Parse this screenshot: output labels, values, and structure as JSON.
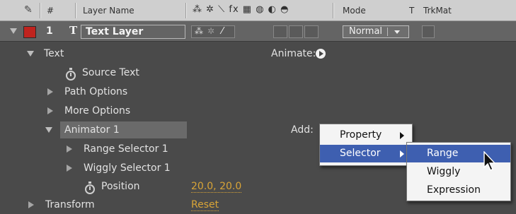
{
  "header": {
    "hash": "#",
    "layer_name": "Layer Name",
    "switch_icons": "⁂ ✲ ⟍ fx ▦ ◍ ◐ ◓",
    "mode": "Mode",
    "t": "T",
    "trkmat": "TrkMat"
  },
  "layer": {
    "number": "1",
    "type_icon": "T",
    "name": "Text Layer",
    "label_color": "#c0231e",
    "mode_value": "Normal"
  },
  "tree": {
    "text": "Text",
    "animate_label": "Animate:",
    "source_text": "Source Text",
    "path_options": "Path Options",
    "more_options": "More Options",
    "animator": "Animator 1",
    "add_label": "Add:",
    "range_selector": "Range Selector 1",
    "wiggly_selector": "Wiggly Selector 1",
    "position_label": "Position",
    "position_value": "20.0, 20.0",
    "transform": "Transform",
    "transform_value": "Reset"
  },
  "menu1": {
    "items": [
      "Property",
      "Selector"
    ]
  },
  "menu2": {
    "items": [
      "Range",
      "Wiggly",
      "Expression"
    ]
  }
}
